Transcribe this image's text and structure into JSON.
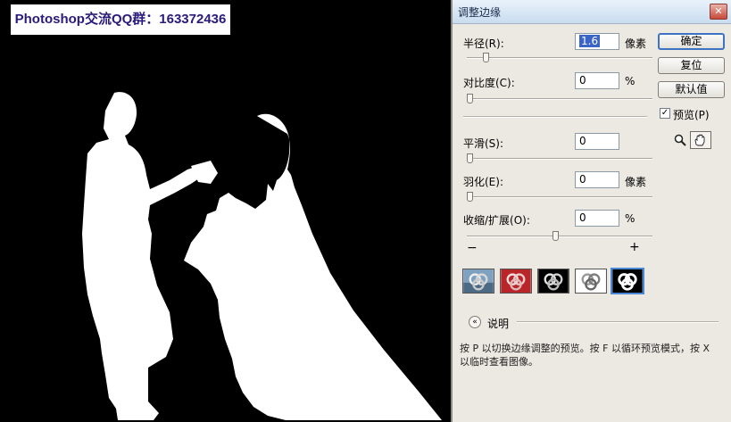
{
  "watermark": "Photoshop交流QQ群：163372436",
  "dialog": {
    "title": "调整边缘",
    "close_label": "✕",
    "fields": [
      {
        "label": "半径(R):",
        "value": "1.6",
        "unit": "像素",
        "slider": 0.1
      },
      {
        "label": "对比度(C):",
        "value": "0",
        "unit": "%",
        "slider": 0
      },
      {
        "label": "平滑(S):",
        "value": "0",
        "unit": "",
        "slider": 0
      },
      {
        "label": "羽化(E):",
        "value": "0",
        "unit": "像素",
        "slider": 0
      },
      {
        "label": "收缩/扩展(O):",
        "value": "0",
        "unit": "%",
        "slider": 0.5
      }
    ],
    "slider_minus": "−",
    "slider_plus": "+",
    "buttons": {
      "ok": "确定",
      "reset": "复位",
      "default": "默认值"
    },
    "preview_label": "预览(P)",
    "preview_checked": true,
    "zoom_icon": "zoom-icon",
    "hand_icon": "hand-icon",
    "preview_modes": [
      "standard",
      "quick-mask",
      "on-black",
      "on-white",
      "mask"
    ],
    "selected_mode": 4,
    "info_label": "说明",
    "info_text": "按 P 以切换边缘调整的预览。按 F 以循环预览模式，按 X 以临时查看图像。"
  }
}
